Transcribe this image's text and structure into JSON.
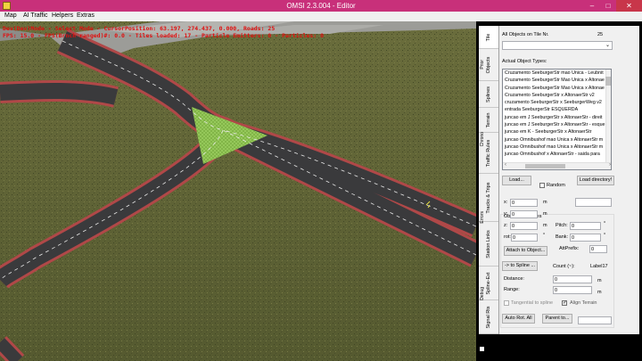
{
  "window": {
    "title": "OMSI 2.3.004 - Editor",
    "minimize": "–",
    "maximize": "□",
    "close": "✕"
  },
  "menu": [
    "Map",
    "AI Traffic",
    "Helpers",
    "Extras"
  ],
  "hud": {
    "line1": "Dev(Dev)Mode - Select Mode - CursorPosition: 63.197, 274.437, 0.000, Roads: 25",
    "line2": "FPS: 15.0 - FPS(Brnch ranged)#: 0.0 - Tiles loaded: 17 - Particle Emitters: 0 - Particles: 0"
  },
  "tabs": [
    "Tile",
    "Objects",
    "Splines",
    "Terrain",
    "Traffic Rules",
    "Tracks & Trips",
    "Station Links",
    "Spline-Ext",
    "Signal Rts"
  ],
  "side_labels": {
    "prior": "Prior",
    "chrono": "Chrono",
    "errors": "Errors",
    "debug": "Debug"
  },
  "panel": {
    "all_objects_label": "All Objects on Tile Nr.",
    "tile_number": "25",
    "actual_types_label": "Actual Object Types:",
    "object_types": [
      "Cruzamento SeeburgerStr mao Unica - Leubnit",
      "Cruzamento SeeburgerStr Mao Unica x Altonae",
      "Cruzamento SeeburgerStr Mao Unica x Altonae",
      "Cruzamento SeeburgerStr x AltonaerStr v2",
      "cruzamento SeeburgerStr x SeeburgerWeg v2",
      "entrada SeeburgerStr ESQUERDA",
      "juncao em J SeeburgerStr x AltonaerStr - direit",
      "juncao em J SeeburgerStr x AltonaerStr - esque",
      "juncao em K - SeeburgerStr x AltonaerStr",
      "juncao Omnibushof mao Unica x AltonaerStr m",
      "juncao Omnibushof mao Unica x AltonaerStr m",
      "juncao Omnibushof x AltonaerStr - saida para"
    ],
    "load_button": "Load...",
    "random_label": "Random",
    "load_directory_button": "Load directory!",
    "object_properties_label": "Object Properties",
    "x_label": "x:",
    "x_value": "0",
    "y_label": "y:",
    "y_value": "0",
    "z_label": "z:",
    "z_value": "0",
    "unit_m": "m",
    "unit_deg": "°",
    "pitch_label": "Pitch:",
    "pitch_value": "0",
    "rot_label": "rot:",
    "rot_value": "0",
    "bank_label": "Bank:",
    "bank_value": "0",
    "attprefix_label": "AttPrefix:",
    "attprefix_value": "0",
    "attach_button": "Attach to Object...",
    "to_spline_button": "-> to Spline ...",
    "count_label": "Count (~):",
    "count_value": "Label17",
    "distance_label": "Distance:",
    "distance_value": "0",
    "range_label": "Range:",
    "range_value": "0",
    "tangential_label": "Tangential to spline",
    "align_terrain_label": "Align Terrain",
    "auto_rot_button": "Auto Rot. All",
    "parent_button": "Parent to...",
    "parent_value": ""
  },
  "colors": {
    "titlebar": "#c8307a",
    "close": "#c8364a",
    "hud_text": "#e01010",
    "terrain": "#5d6134",
    "road": "#3a3a3c",
    "curb": "#b04848",
    "grass_island": "#86b84a"
  },
  "icons": [
    "app-icon",
    "chevron-down-icon",
    "arrow-left-icon",
    "arrow-right-icon",
    "checkmark-icon"
  ]
}
